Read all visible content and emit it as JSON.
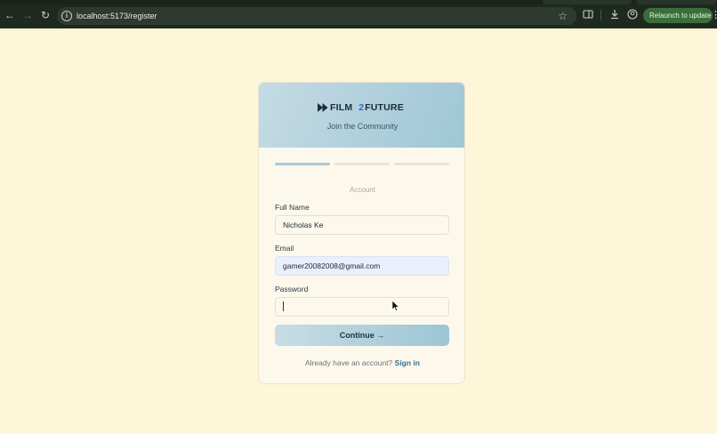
{
  "browser": {
    "url": "localhost:5173/register",
    "relaunch_label": "Relaunch to update",
    "icons": {
      "back": "arrow-left-icon",
      "forward": "arrow-right-icon",
      "reload": "reload-icon",
      "site_info": "info-icon",
      "bookmark": "star-icon",
      "reading": "reading-mode-icon",
      "download": "download-icon",
      "profile": "profile-icon",
      "menu": "kebab-icon"
    }
  },
  "brand": {
    "word1": "FILM",
    "number": "2",
    "word2": "FUTURE",
    "tagline": "Join the Community",
    "colors": {
      "header_gradient_start": "#c4dbe4",
      "header_gradient_end": "#9fc6d6",
      "accent_number": "#2d6fbf",
      "page_background": "#fdf6d8"
    }
  },
  "progress": {
    "steps_total": 3,
    "current_step": 1
  },
  "form": {
    "step_label": "Account",
    "full_name": {
      "label": "Full Name",
      "value": "Nicholas Ke"
    },
    "email": {
      "label": "Email",
      "value": "gamer20082008@gmail.com"
    },
    "password": {
      "label": "Password",
      "value": ""
    },
    "continue_label": "Continue →",
    "signin_prompt": "Already have an account?",
    "signin_link": "Sign in"
  }
}
